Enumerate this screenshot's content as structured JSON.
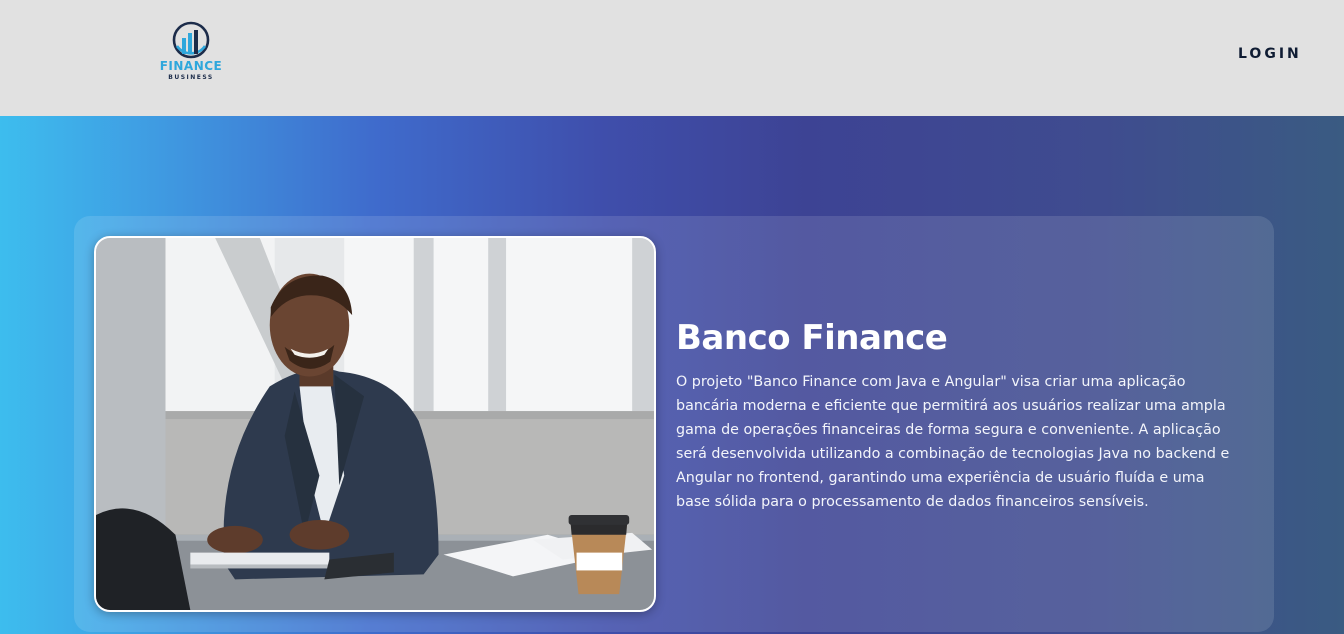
{
  "navbar": {
    "logo": {
      "title": "FINANCE",
      "subtitle": "BUSINESS",
      "icon": "bar-chart-circle-icon",
      "colors": {
        "primary": "#2ea7dc",
        "dark": "#1c2c4a"
      }
    },
    "login_label": "LOGIN"
  },
  "hero": {
    "title": "Banco Finance",
    "description": "O projeto \"Banco Finance com Java e Angular\" visa criar uma aplicação bancária moderna e eficiente que permitirá aos usuários realizar uma ampla gama de operações financeiras de forma segura e conveniente. A aplicação será desenvolvida utilizando a combinação de tecnologias Java no backend e Angular no frontend, garantindo uma experiência de usuário fluída e uma base sólida para o processamento de dados financeiros sensíveis.",
    "gradient": [
      "#3dbdee",
      "#3f6bcc",
      "#3d4394",
      "#3a5b82"
    ]
  },
  "colors": {
    "navbar_bg": "#e1e1e1",
    "login_text": "#0f1c33",
    "text_light": "#ffffff"
  }
}
